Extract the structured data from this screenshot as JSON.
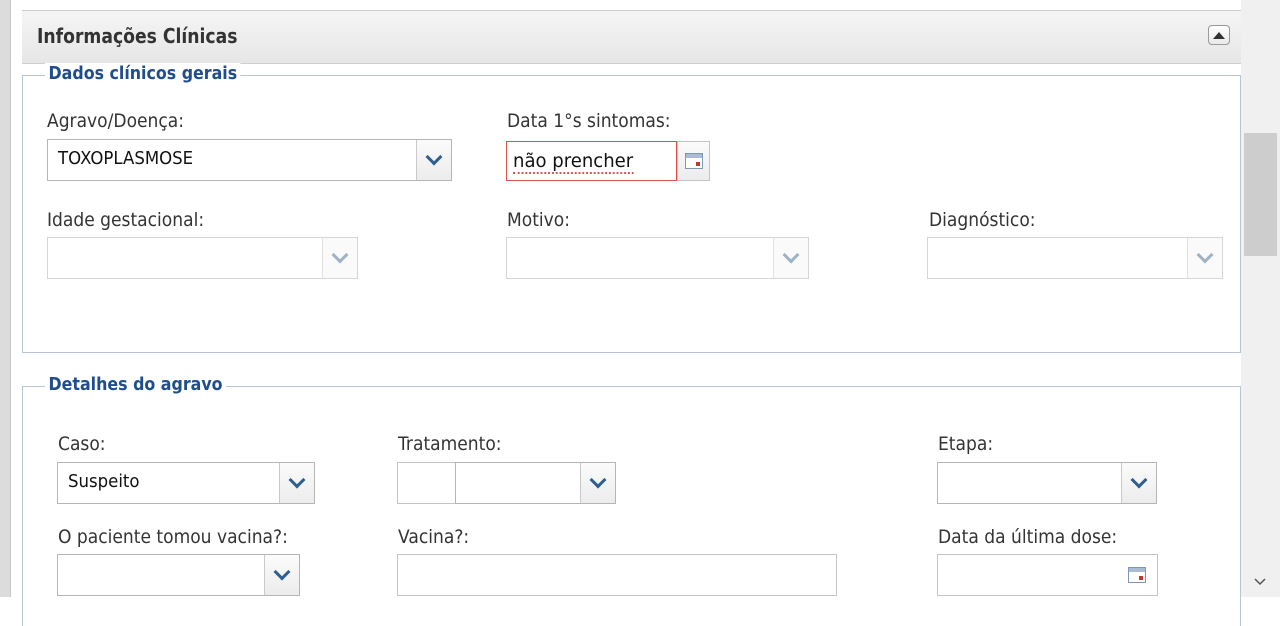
{
  "panel": {
    "title": "Informações Clínicas"
  },
  "general": {
    "legend": "Dados clínicos gerais",
    "agravo_label": "Agravo/Doença:",
    "agravo_value": "TOXOPLASMOSE",
    "data_sintomas_label": "Data 1°s sintomas:",
    "data_sintomas_value": "não prencher",
    "idade_label": "Idade gestacional:",
    "motivo_label": "Motivo:",
    "diagnostico_label": "Diagnóstico:"
  },
  "details": {
    "legend": "Detalhes do agravo",
    "caso_label": "Caso:",
    "caso_value": "Suspeito",
    "tratamento_label": "Tratamento:",
    "etapa_label": "Etapa:",
    "vacina_tomou_label": "O paciente tomou vacina?:",
    "vacina_label": "Vacina?:",
    "ultima_dose_label": "Data da última dose:"
  },
  "icons": {
    "collapse": "chevron-up-icon",
    "dropdown": "chevron-down-icon",
    "calendar": "calendar-icon"
  },
  "colors": {
    "legend_text": "#1f4e8c",
    "fieldset_border": "#b9c4d6",
    "invalid_border": "#d9534f",
    "chevron": "#2f5f91"
  }
}
